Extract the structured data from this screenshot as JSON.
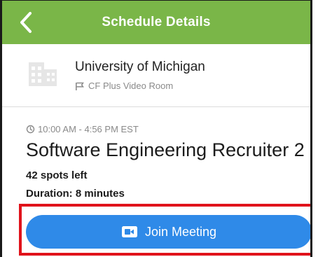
{
  "header": {
    "title": "Schedule Details",
    "back_icon": "chevron-left-icon",
    "background_color": "#7ab648"
  },
  "company": {
    "name": "University of Michigan",
    "icon": "building-icon",
    "room_icon": "flag-icon",
    "room": "CF Plus Video Room"
  },
  "schedule": {
    "time_icon": "clock-icon",
    "time": "10:00 AM - 4:56 PM EST",
    "title": "Software Engineering Recruiter 2",
    "spots_left": "42 spots left",
    "duration": "Duration: 8 minutes"
  },
  "join_button": {
    "label": "Join Meeting",
    "icon": "video-camera-icon",
    "color": "#2f8ae8"
  },
  "highlight_color": "#e0131b"
}
